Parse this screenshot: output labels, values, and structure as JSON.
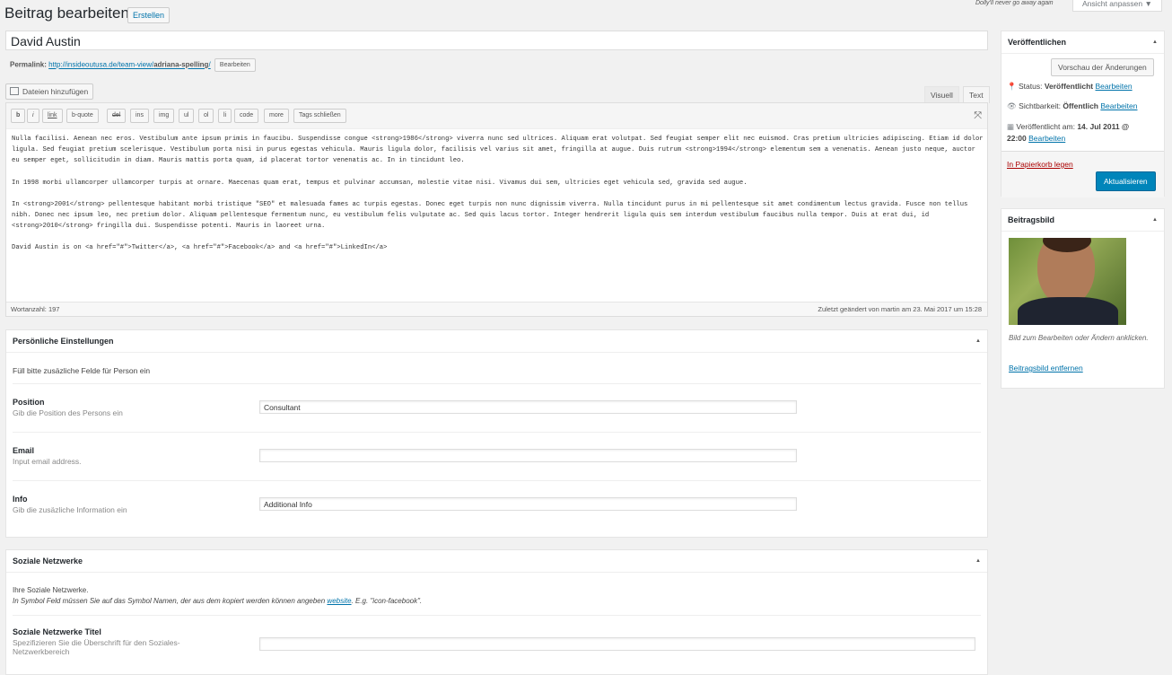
{
  "header": {
    "title": "Beitrag bearbeiten",
    "add_new": "Erstellen",
    "dolly": "Dolly'll never go away again",
    "screen_options": "Ansicht anpassen ▼"
  },
  "post": {
    "title": "David Austin",
    "permalink_label": "Permalink:",
    "permalink_base": "http://insideoutusa.de/team-view/",
    "permalink_slug": "adriana-spelling",
    "permalink_end": "/",
    "permalink_edit": "Bearbeiten"
  },
  "editor": {
    "add_media": "Dateien hinzufügen",
    "tab_visual": "Visuell",
    "tab_text": "Text",
    "toolbar": [
      "b",
      "i",
      "link",
      "b-quote",
      "del",
      "ins",
      "img",
      "ul",
      "ol",
      "li",
      "code",
      "more",
      "Tags schließen"
    ],
    "paragraphs": [
      "Nulla facilisi. Aenean nec eros. Vestibulum ante ipsum primis in faucibu. Suspendisse congue <strong>1986</strong> viverra nunc sed ultrices. Aliquam erat volutpat. Sed feugiat semper elit nec euismod. Cras pretium ultricies adipiscing. Etiam id dolor ligula. Sed feugiat pretium scelerisque. Vestibulum porta nisi in purus egestas vehicula. Mauris ligula dolor, facilisis vel varius sit amet, fringilla at augue. Duis rutrum <strong>1994</strong> elementum sem a venenatis. Aenean justo neque, auctor eu semper eget, sollicitudin in diam. Mauris mattis porta quam, id placerat tortor venenatis ac. In in tincidunt leo.",
      "In 1998 morbi ullamcorper ullamcorper turpis at ornare. Maecenas quam erat, tempus et pulvinar accumsan, molestie vitae nisi. Vivamus dui sem, ultricies eget vehicula sed, gravida sed augue.",
      "In <strong>2001</strong> pellentesque habitant morbi tristique \"SEO\" et malesuada fames ac turpis egestas. Donec eget turpis non nunc dignissim viverra. Nulla tincidunt purus in mi pellentesque sit amet condimentum lectus gravida. Fusce non tellus nibh. Donec nec ipsum leo, nec pretium dolor. Aliquam pellentesque fermentum nunc, eu vestibulum felis vulputate ac. Sed quis lacus tortor. Integer hendrerit ligula quis sem interdum vestibulum faucibus nulla tempor. Duis at erat dui, id <strong>2010</strong> fringilla dui. Suspendisse potenti. Mauris in laoreet urna.",
      "David Austin is on <a href=\"#\">Twitter</a>, <a href=\"#\">Facebook</a> and <a href=\"#\">LinkedIn</a>"
    ],
    "word_count": "Wortanzahl: 197",
    "last_modified": "Zuletzt geändert von martin am 23. Mai 2017 um 15:28"
  },
  "personal": {
    "title": "Persönliche Einstellungen",
    "intro": "Füll bitte zusäzliche Felde für Person ein",
    "fields": [
      {
        "label": "Position",
        "desc": "Gib die Position des Persons ein",
        "value": "Consultant"
      },
      {
        "label": "Email",
        "desc": "Input email address.",
        "value": ""
      },
      {
        "label": "Info",
        "desc": "Gib die zusäzliche Information ein",
        "value": "Additional Info"
      }
    ]
  },
  "social": {
    "title": "Soziale Netzwerke",
    "intro1": "Ihre Soziale Netzwerke.",
    "intro2_pre": "In Symbol Feld müssen Sie auf das Symbol Namen, der aus dem kopiert werden können angeben ",
    "intro2_link": "website",
    "intro2_post": ". E.g. \"icon-facebook\".",
    "field_label": "Soziale Netzwerke Titel",
    "field_desc": "Spezifizieren Sie die Überschrift für den Soziales-Netzwerkbereich",
    "field_value": ""
  },
  "publish": {
    "title": "Veröffentlichen",
    "preview": "Vorschau der Änderungen",
    "status_label": "Status:",
    "status_value": "Veröffentlicht",
    "visibility_label": "Sichtbarkeit:",
    "visibility_value": "Öffentlich",
    "published_label": "Veröffentlicht am:",
    "published_value_1": "14. Jul 2011 @",
    "published_value_2": "22:00",
    "edit": "Bearbeiten",
    "trash": "In Papierkorb legen",
    "update": "Aktualisieren"
  },
  "featured": {
    "title": "Beitragsbild",
    "hint": "Bild zum Bearbeiten oder Ändern anklicken.",
    "remove": "Beitragsbild entfernen"
  }
}
